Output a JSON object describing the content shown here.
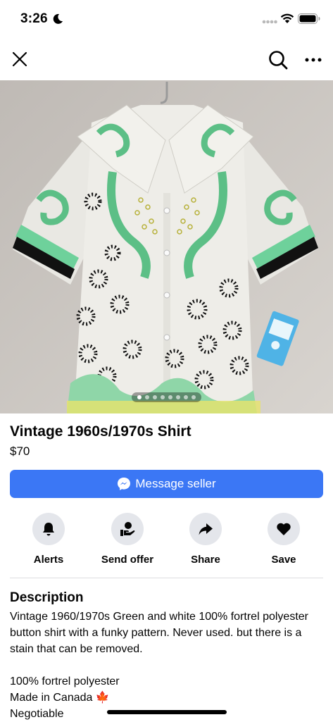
{
  "status_bar": {
    "time": "3:26"
  },
  "listing": {
    "title": "Vintage 1960s/1970s Shirt",
    "price": "$70",
    "message_label": "Message seller",
    "photo_count": 8,
    "active_photo": 1
  },
  "actions": [
    {
      "label": "Alerts",
      "icon": "bell-icon"
    },
    {
      "label": "Send offer",
      "icon": "offer-icon"
    },
    {
      "label": "Share",
      "icon": "share-arrow-icon"
    },
    {
      "label": "Save",
      "icon": "heart-icon"
    }
  ],
  "description": {
    "heading": "Description",
    "lines": [
      "Vintage 1960/1970s Green and white 100% fortrel polyester button shirt with a funky pattern. Never used. but there is a stain that can be removed.",
      "",
      "100% fortrel polyester",
      "Made in Canada 🍁",
      "Negotiable"
    ]
  },
  "colors": {
    "accent": "#3b77f5",
    "action_bg": "#e4e6eb"
  }
}
